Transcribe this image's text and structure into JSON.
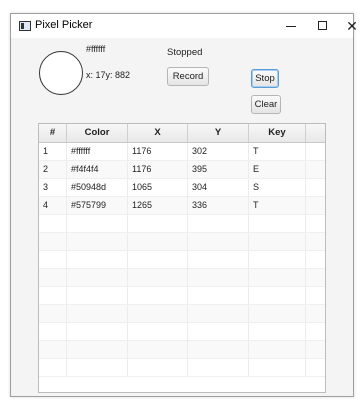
{
  "window": {
    "title": "Pixel Picker",
    "controls": {
      "minimize": "—",
      "maximize": "☐",
      "close": "✕"
    }
  },
  "picker": {
    "preview_color": "#ffffff",
    "color_text": "#ffffff",
    "coords_text": "x: 17y: 882",
    "status": "Stopped"
  },
  "buttons": {
    "record": "Record",
    "stop": "Stop",
    "clear": "Clear"
  },
  "table": {
    "headers": [
      "#",
      "Color",
      "X",
      "Y",
      "Key"
    ],
    "rows": [
      {
        "num": "1",
        "color": "#ffffff",
        "x": "1176",
        "y": "302",
        "key": "T"
      },
      {
        "num": "2",
        "color": "#f4f4f4",
        "x": "1176",
        "y": "395",
        "key": "E"
      },
      {
        "num": "3",
        "color": "#50948d",
        "x": "1065",
        "y": "304",
        "key": "S"
      },
      {
        "num": "4",
        "color": "#575799",
        "x": "1265",
        "y": "336",
        "key": "T"
      }
    ]
  }
}
